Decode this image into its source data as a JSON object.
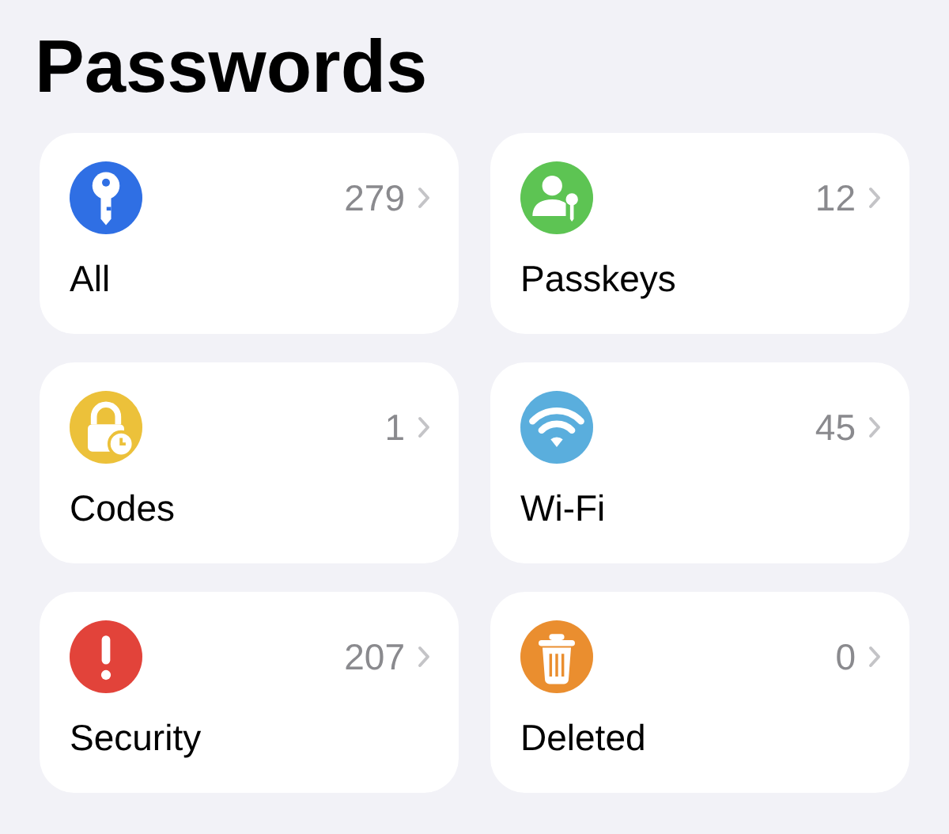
{
  "title": "Passwords",
  "categories": [
    {
      "kind": "key",
      "color": "#2f6fe4",
      "label": "All",
      "count": "279"
    },
    {
      "kind": "person-key",
      "color": "#5dc453",
      "label": "Passkeys",
      "count": "12"
    },
    {
      "kind": "lock-clock",
      "color": "#ecc13a",
      "label": "Codes",
      "count": "1"
    },
    {
      "kind": "wifi",
      "color": "#5aaedd",
      "label": "Wi-Fi",
      "count": "45"
    },
    {
      "kind": "alert",
      "color": "#e2433a",
      "label": "Security",
      "count": "207"
    },
    {
      "kind": "trash",
      "color": "#ea8e2f",
      "label": "Deleted",
      "count": "0"
    }
  ]
}
